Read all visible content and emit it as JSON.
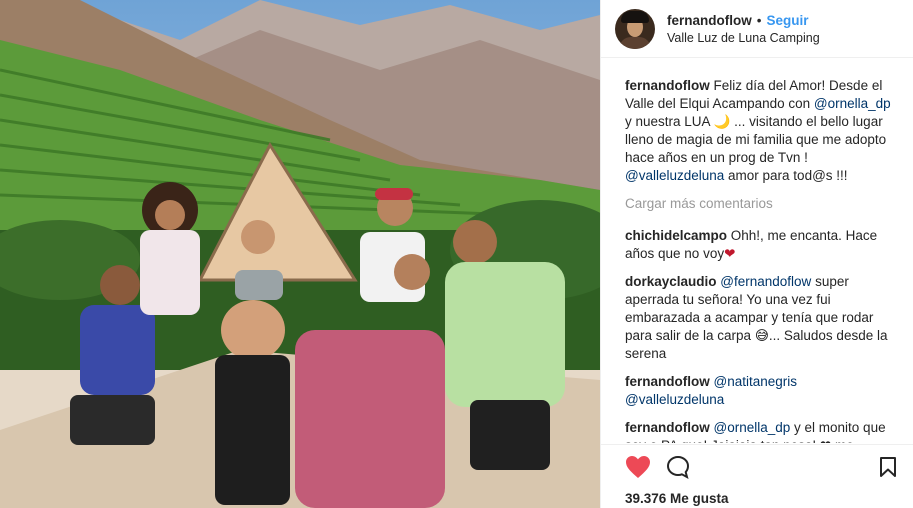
{
  "header": {
    "username": "fernandoflow",
    "separator": "•",
    "follow_label": "Seguir",
    "location": "Valle Luz de Luna Camping"
  },
  "caption": {
    "user": "fernandoflow",
    "text_1": " Feliz día del Amor! Desde el Valle del Elqui Acampando con ",
    "mention_1": "@ornella_dp",
    "text_2": " y nuestra LUA 🌙 ... visitando el bello lugar lleno de magia de mi familia que me adopto hace años en un prog de Tvn ! ",
    "mention_2": "@valleluzdeluna",
    "text_3": " amor para tod@s !!!"
  },
  "load_more_label": "Cargar más comentarios",
  "comments": [
    {
      "user": "chichidelcampo",
      "text": " Ohh!, me encanta. Hace años que no voy",
      "emoji": "❤"
    },
    {
      "user": "dorkayclaudio",
      "mention": "@fernandoflow",
      "text": " super aperrada tu señora! Yo una vez fui embarazada a acampar y tenía que rodar para salir de la carpa 😅... Saludos desde la serena"
    },
    {
      "user": "fernandoflow",
      "mention": "@natitanegris",
      "mention_2": "@valleluzdeluna"
    },
    {
      "user": "fernandoflow",
      "mention": "@ornella_dp",
      "text": " y el monito que soy o PA que! Jajajaja tan pesa! ❤ me"
    }
  ],
  "likes": "39.376 Me gusta",
  "icons": {
    "like": "heart-icon",
    "comment": "comment-bubble-icon",
    "save": "bookmark-icon"
  },
  "colors": {
    "link": "#003569",
    "follow": "#3897f0",
    "heart": "#ed4956"
  }
}
